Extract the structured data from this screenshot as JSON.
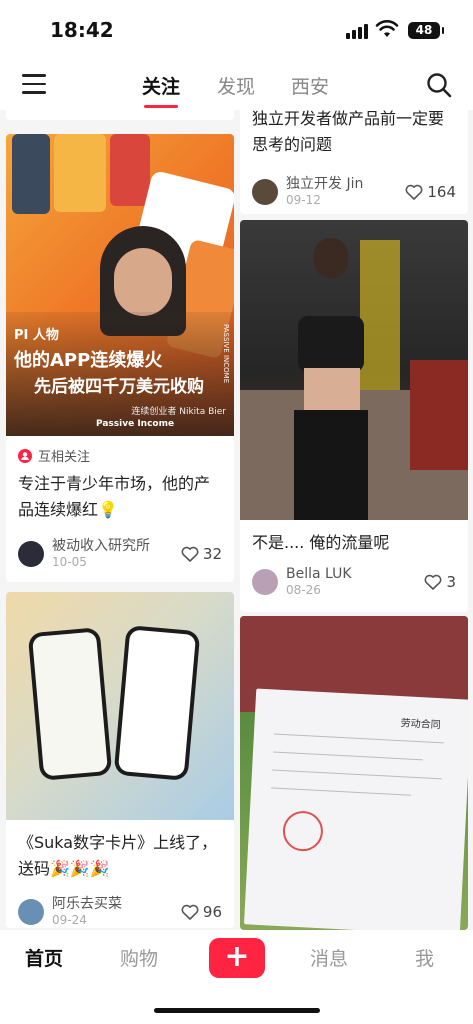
{
  "status": {
    "time": "18:42",
    "battery": "48"
  },
  "topnav": {
    "tabs": [
      {
        "label": "关注",
        "active": true
      },
      {
        "label": "发现",
        "active": false
      },
      {
        "label": "西安",
        "active": false
      }
    ]
  },
  "feed": {
    "left": [
      {
        "cover": {
          "tag": "PI 人物",
          "headline1": "他的APP连续爆火",
          "headline2": "先后被四千万美元收购",
          "caption": "连续创业者 Nikita Bier",
          "brand": "Passive Income",
          "vertical_text": "PASSIVE INCOME"
        },
        "badge": "互相关注",
        "title": "专注于青少年市场，他的产品连续爆红💡",
        "author": "被动收入研究所",
        "date": "10-05",
        "likes": "32"
      },
      {
        "title": "《Suka数字卡片》上线了，送码🎉🎉🎉",
        "author": "阿乐去买菜",
        "date": "09-24",
        "likes": "96"
      }
    ],
    "right": [
      {
        "title": "独立开发者做产品前一定要思考的问题",
        "author": "独立开发 Jin",
        "date": "09-12",
        "likes": "164"
      },
      {
        "title": "不是.... 俺的流量呢",
        "author": "Bella LUK",
        "date": "08-26",
        "likes": "3"
      },
      {
        "doc_header": "劳动合同"
      }
    ]
  },
  "bottomnav": {
    "items": [
      {
        "label": "首页",
        "active": true
      },
      {
        "label": "购物",
        "active": false
      },
      {
        "label": "+",
        "active": false
      },
      {
        "label": "消息",
        "active": false
      },
      {
        "label": "我",
        "active": false
      }
    ]
  },
  "colors": {
    "accent": "#ff2442"
  }
}
